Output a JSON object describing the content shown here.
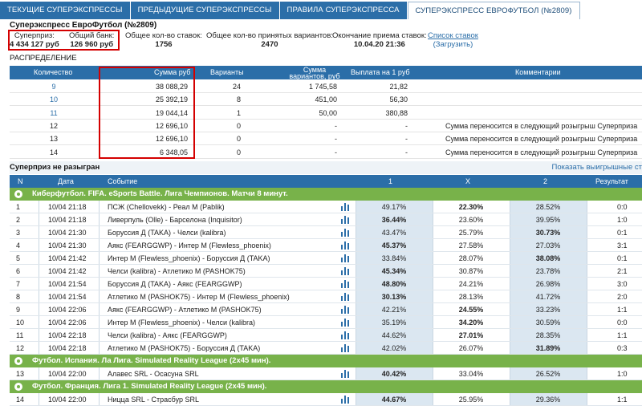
{
  "tabs": [
    "ТЕКУЩИЕ СУПЕРЭКСПРЕССЫ",
    "ПРЕДЫДУЩИЕ СУПЕРЭКСПРЕССЫ",
    "ПРАВИЛА СУПЕРЭКСПРЕССА",
    "СУПЕРЭКСПРЕСС ЕВРОФУТБОЛ (№2809)"
  ],
  "page_title": "Суперэкспресс ЕвроФутбол (№2809)",
  "stats": {
    "superprize_label": "Суперприз:",
    "superprize_value": "4 434 127 руб",
    "bank_label": "Общий банк:",
    "bank_value": "126 960 руб",
    "bets_label": "Общее кол-во ставок:",
    "bets_value": "1756",
    "variants_label": "Общее кол-во принятых вариантов:",
    "variants_value": "2470",
    "end_label": "Окончание приема ставок:",
    "end_value": "10.04.20 21:36",
    "link_label": "Список ставок",
    "link_sub": "(Загрузить)"
  },
  "distribution": {
    "label": "РАСПРЕДЕЛЕНИЕ",
    "headers": [
      "Количество",
      "Сумма руб",
      "Варианты",
      "Сумма вариантов, руб",
      "Выплата на 1 руб",
      "Комментарии"
    ],
    "rows": [
      {
        "count": "9",
        "sum": "38 088,29",
        "variants": "24",
        "vsum": "1 745,58",
        "payout": "21,82",
        "comment": ""
      },
      {
        "count": "10",
        "sum": "25 392,19",
        "variants": "8",
        "vsum": "451,00",
        "payout": "56,30",
        "comment": ""
      },
      {
        "count": "11",
        "sum": "19 044,14",
        "variants": "1",
        "vsum": "50,00",
        "payout": "380,88",
        "comment": ""
      },
      {
        "count": "12",
        "sum": "12 696,10",
        "variants": "0",
        "vsum": "-",
        "payout": "-",
        "comment": "Сумма переносится в следующий розыгрыш Суперприза"
      },
      {
        "count": "13",
        "sum": "12 696,10",
        "variants": "0",
        "vsum": "-",
        "payout": "-",
        "comment": "Сумма переносится в следующий розыгрыш Суперприза"
      },
      {
        "count": "14",
        "sum": "6 348,05",
        "variants": "0",
        "vsum": "-",
        "payout": "-",
        "comment": "Сумма переносится в следующий розыгрыш Суперприза"
      }
    ]
  },
  "subbar": {
    "left": "Суперприз не разыгран",
    "right": "Показать выигрышные ст"
  },
  "table_headers": [
    "N",
    "Дата",
    "Событие",
    "1",
    "X",
    "2",
    "Результат"
  ],
  "groups": [
    {
      "title": "Киберфутбол. FIFA. eSports Battle. Лига Чемпионов. Матчи 8 минут."
    },
    {
      "title": "Футбол. Испания. Ла Лига. Simulated Reality League (2x45 мин)."
    },
    {
      "title": "Футбол. Франция. Лига 1. Simulated Reality League (2x45 мин)."
    }
  ],
  "events": [
    {
      "n": "1",
      "date": "10/04 21:18",
      "event": "ПСЖ (Chellovekk) - Реал М (Pablik)",
      "p1": "49.17%",
      "px": "22.30%",
      "p2": "28.52%",
      "res": "0:0",
      "bold": "x"
    },
    {
      "n": "2",
      "date": "10/04 21:18",
      "event": "Ливерпуль (Olle) - Барселона (Inquisitor)",
      "p1": "36.44%",
      "px": "23.60%",
      "p2": "39.95%",
      "res": "1:0",
      "bold": "1"
    },
    {
      "n": "3",
      "date": "10/04 21:30",
      "event": "Боруссия Д (TAKA) - Челси (kalibra)",
      "p1": "43.47%",
      "px": "25.79%",
      "p2": "30.73%",
      "res": "0:1",
      "bold": "2"
    },
    {
      "n": "4",
      "date": "10/04 21:30",
      "event": "Аякс (FEARGGWP) - Интер М (Flewless_phoenix)",
      "p1": "45.37%",
      "px": "27.58%",
      "p2": "27.03%",
      "res": "3:1",
      "bold": "1"
    },
    {
      "n": "5",
      "date": "10/04 21:42",
      "event": "Интер М (Flewless_phoenix) - Боруссия Д (TAKA)",
      "p1": "33.84%",
      "px": "28.07%",
      "p2": "38.08%",
      "res": "0:1",
      "bold": "2"
    },
    {
      "n": "6",
      "date": "10/04 21:42",
      "event": "Челси (kalibra) - Атлетико М (PASHOK75)",
      "p1": "45.34%",
      "px": "30.87%",
      "p2": "23.78%",
      "res": "2:1",
      "bold": "1"
    },
    {
      "n": "7",
      "date": "10/04 21:54",
      "event": "Боруссия Д (TAKA) - Аякс (FEARGGWP)",
      "p1": "48.80%",
      "px": "24.21%",
      "p2": "26.98%",
      "res": "3:0",
      "bold": "1"
    },
    {
      "n": "8",
      "date": "10/04 21:54",
      "event": "Атлетико М (PASHOK75) - Интер М (Flewless_phoenix)",
      "p1": "30.13%",
      "px": "28.13%",
      "p2": "41.72%",
      "res": "2:0",
      "bold": "1"
    },
    {
      "n": "9",
      "date": "10/04 22:06",
      "event": "Аякс (FEARGGWP) - Атлетико М (PASHOK75)",
      "p1": "42.21%",
      "px": "24.55%",
      "p2": "33.23%",
      "res": "1:1",
      "bold": "x"
    },
    {
      "n": "10",
      "date": "10/04 22:06",
      "event": "Интер М (Flewless_phoenix) - Челси (kalibra)",
      "p1": "35.19%",
      "px": "34.20%",
      "p2": "30.59%",
      "res": "0:0",
      "bold": "x"
    },
    {
      "n": "11",
      "date": "10/04 22:18",
      "event": "Челси (kalibra) - Аякс (FEARGGWP)",
      "p1": "44.62%",
      "px": "27.01%",
      "p2": "28.35%",
      "res": "1:1",
      "bold": "x"
    },
    {
      "n": "12",
      "date": "10/04 22:18",
      "event": "Атлетико М (PASHOK75) - Боруссия Д (TAKA)",
      "p1": "42.02%",
      "px": "26.07%",
      "p2": "31.89%",
      "res": "0:3",
      "bold": "2"
    },
    {
      "n": "13",
      "date": "10/04 22:00",
      "event": "Алавес SRL - Осасуна SRL",
      "p1": "40.42%",
      "px": "33.04%",
      "p2": "26.52%",
      "res": "1:0",
      "bold": "1"
    },
    {
      "n": "14",
      "date": "10/04 22:00",
      "event": "Ницца SRL - Страсбур SRL",
      "p1": "44.67%",
      "px": "25.95%",
      "p2": "29.36%",
      "res": "1:1",
      "bold": "1"
    }
  ]
}
